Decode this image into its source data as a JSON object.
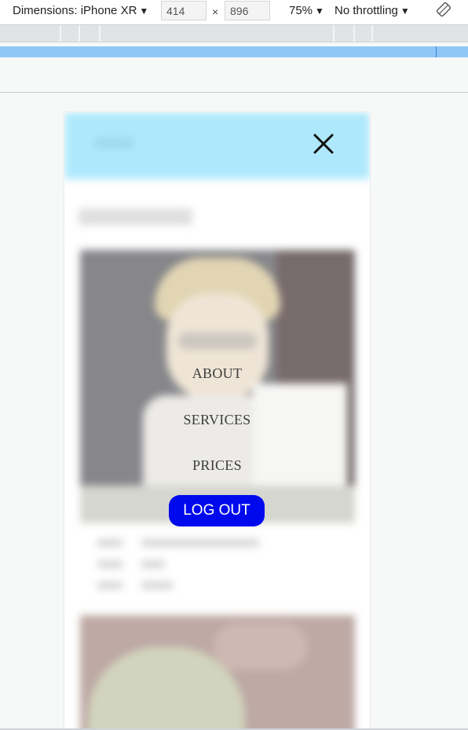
{
  "devtools": {
    "dimensions_label": "Dimensions: iPhone XR",
    "width_value": "414",
    "height_value": "896",
    "times_sign": "×",
    "zoom": "75%",
    "throttling": "No throttling",
    "caret": "▼",
    "rotate_icon": "rotate-icon",
    "media_query_bar_color": "#8fc8f6"
  },
  "app": {
    "header_color": "#93e1fb",
    "close_icon": "close-icon",
    "menu": {
      "items": [
        {
          "label": "ABOUT"
        },
        {
          "label": "SERVICES"
        },
        {
          "label": "PRICES"
        }
      ],
      "logout_label": "LOG OUT",
      "logout_color": "#0009ee"
    }
  }
}
